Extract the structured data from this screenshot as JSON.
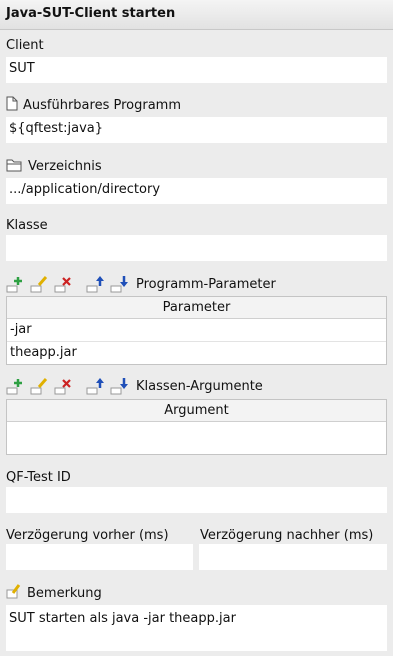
{
  "title": "Java-SUT-Client starten",
  "client": {
    "label": "Client",
    "value": "SUT"
  },
  "program": {
    "label": "Ausführbares Programm",
    "value": "${qftest:java}"
  },
  "directory": {
    "label": "Verzeichnis",
    "value": ".../application/directory"
  },
  "klasse": {
    "label": "Klasse",
    "value": ""
  },
  "program_params": {
    "label": "Programm-Parameter",
    "column": "Parameter",
    "rows": [
      "-jar",
      "theapp.jar"
    ]
  },
  "class_args": {
    "label": "Klassen-Argumente",
    "column": "Argument",
    "rows": []
  },
  "qftest_id": {
    "label": "QF-Test ID",
    "value": ""
  },
  "delay_before": {
    "label": "Verzögerung vorher (ms)",
    "value": ""
  },
  "delay_after": {
    "label": "Verzögerung nachher (ms)",
    "value": ""
  },
  "comment": {
    "label": "Bemerkung",
    "value": "SUT starten als java -jar theapp.jar"
  },
  "toolbar_icons": [
    "add-icon",
    "edit-icon",
    "delete-icon",
    "move-up-icon",
    "move-down-icon"
  ],
  "colors": {
    "add": "#2ea043",
    "edit": "#e0b000",
    "delete": "#cc2222",
    "arrow": "#1f4fb8"
  }
}
